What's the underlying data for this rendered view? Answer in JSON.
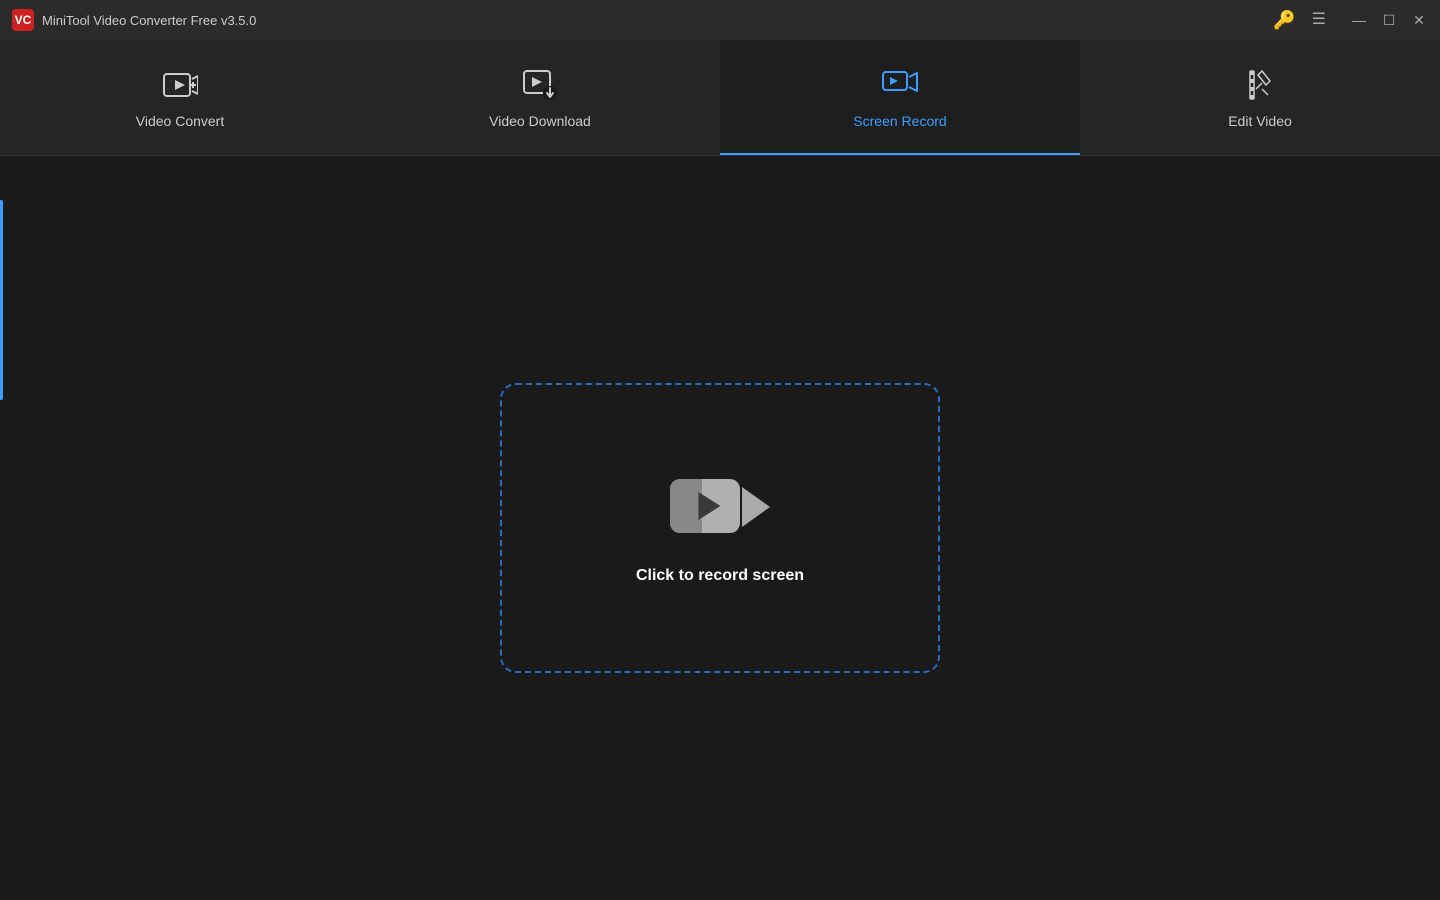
{
  "app": {
    "title": "MiniTool Video Converter Free v3.5.0",
    "logo_text": "VC"
  },
  "titlebar": {
    "key_icon": "🔑",
    "menu_icon": "☰",
    "minimize_icon": "—",
    "maximize_icon": "☐",
    "close_icon": "✕"
  },
  "tabs": [
    {
      "id": "video-convert",
      "label": "Video Convert",
      "active": false
    },
    {
      "id": "video-download",
      "label": "Video Download",
      "active": false
    },
    {
      "id": "screen-record",
      "label": "Screen Record",
      "active": true
    },
    {
      "id": "edit-video",
      "label": "Edit Video",
      "active": false
    }
  ],
  "main": {
    "record_prompt": "Click to record screen"
  },
  "colors": {
    "accent_blue": "#3b9eff",
    "active_tab_bg": "#1e1e1e",
    "bg": "#1a1a1a",
    "titlebar_bg": "#2b2b2b",
    "nav_bg": "#252525",
    "key_color": "#d4a017",
    "dashed_border": "#2a6bbf"
  }
}
